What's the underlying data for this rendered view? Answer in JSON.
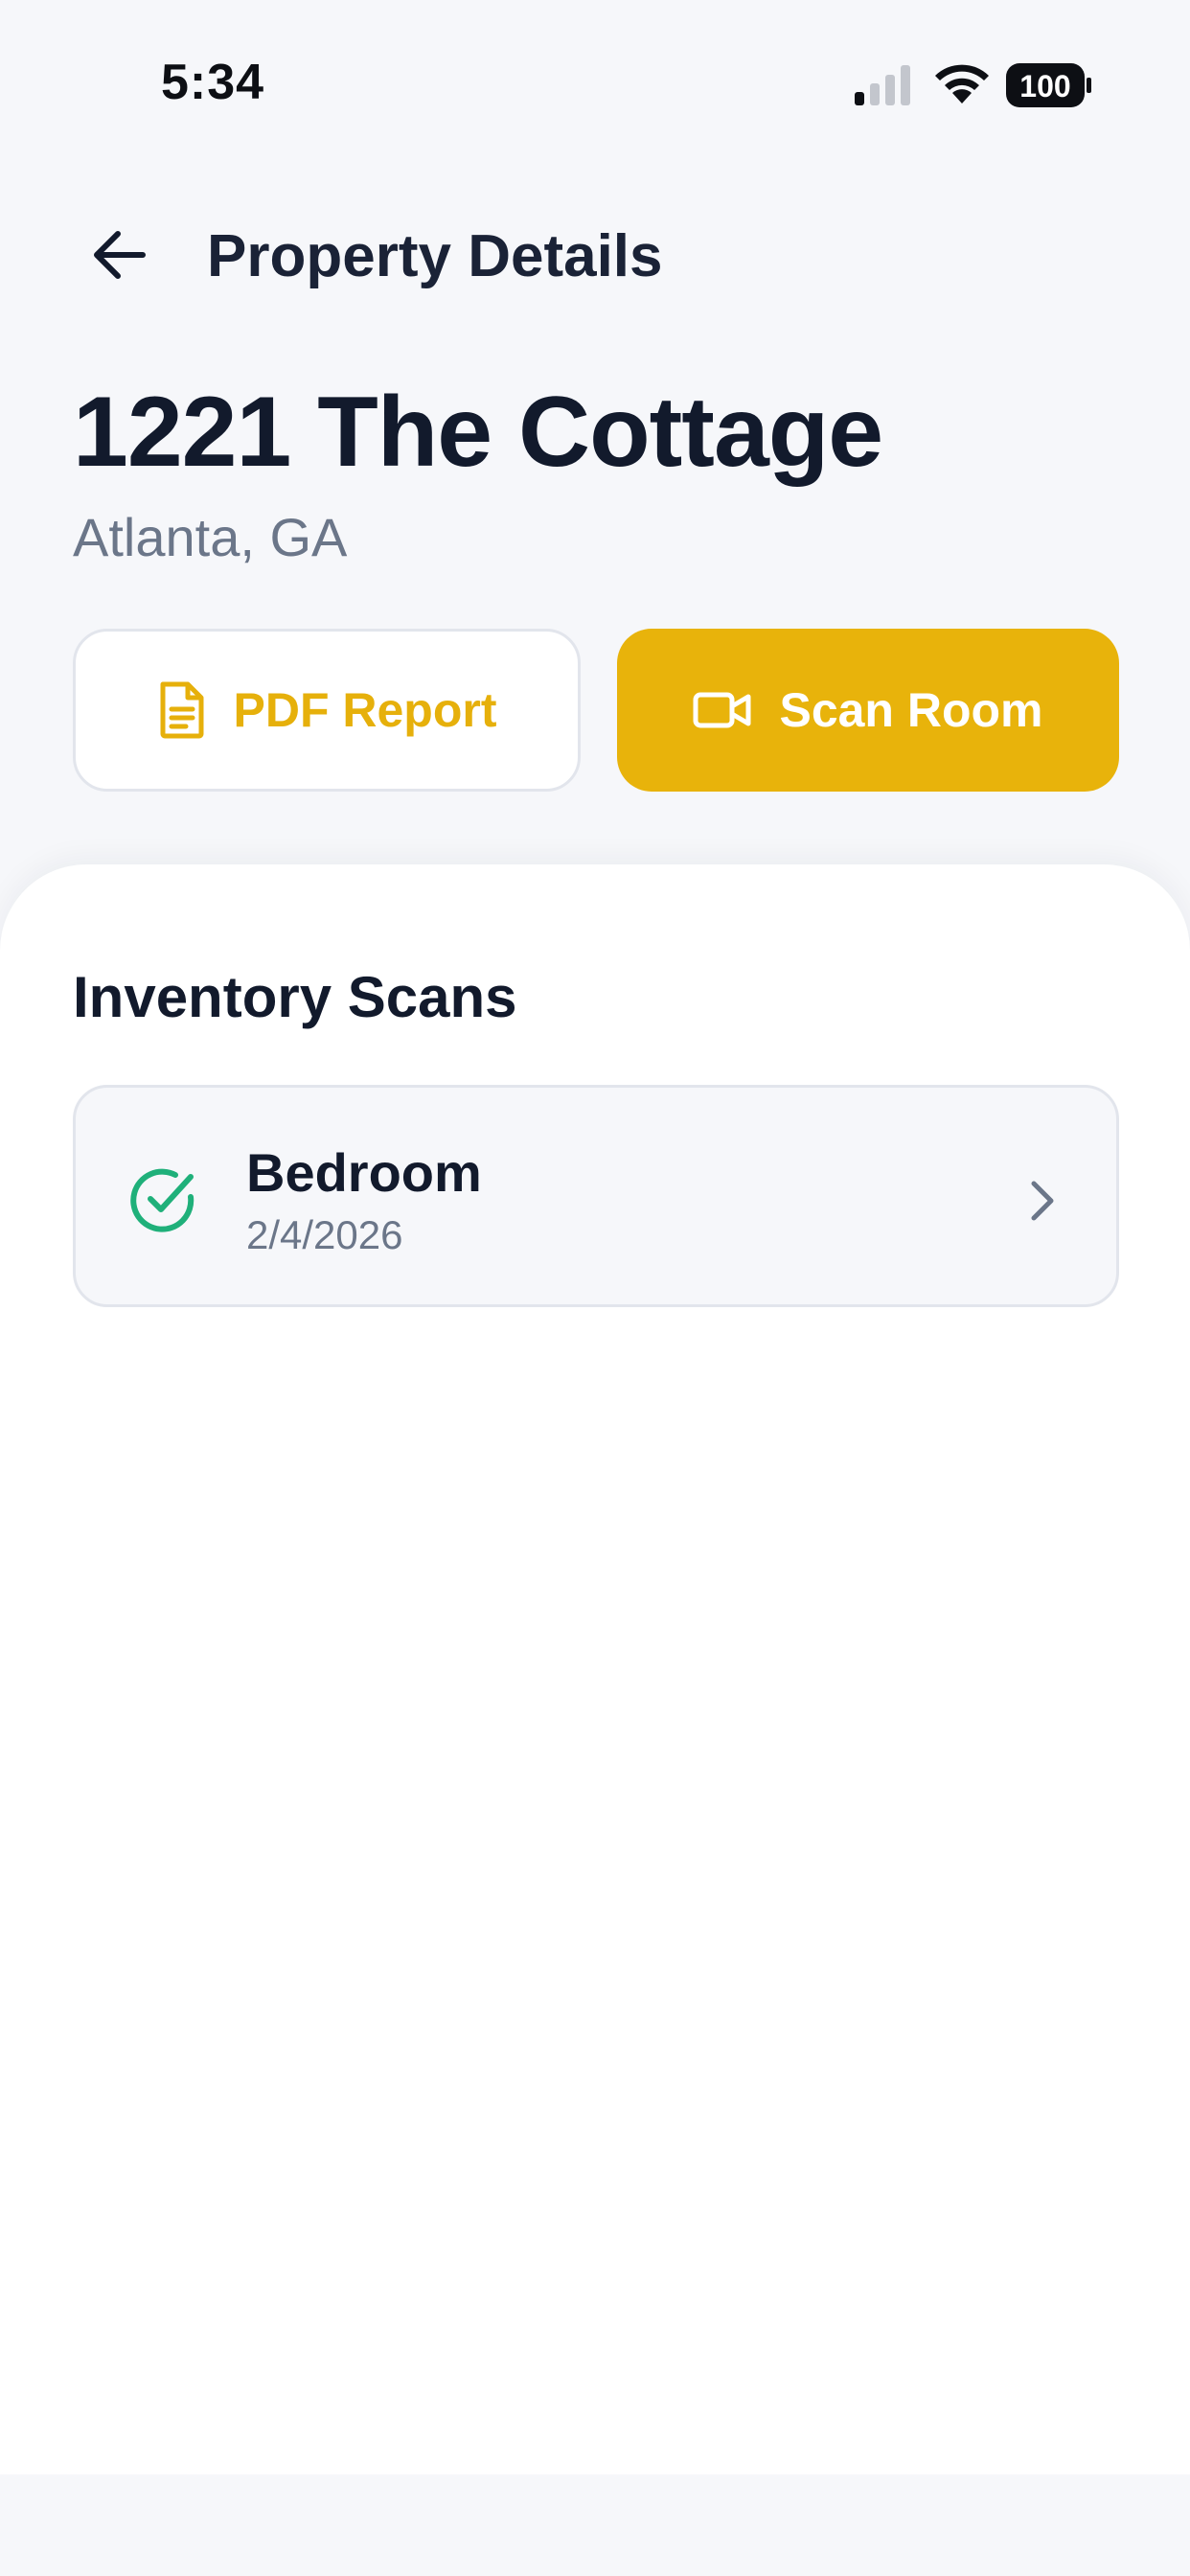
{
  "status_bar": {
    "time": "5:34",
    "battery": "100",
    "signal_icon": "cellular-signal-icon",
    "wifi_icon": "wifi-icon",
    "battery_icon": "battery-icon"
  },
  "header": {
    "back_icon": "arrow-left-icon",
    "title": "Property Details"
  },
  "property": {
    "name": "1221 The Cottage",
    "location": "Atlanta, GA"
  },
  "actions": {
    "pdf_label": "PDF Report",
    "pdf_icon": "document-icon",
    "scan_label": "Scan Room",
    "scan_icon": "video-camera-icon"
  },
  "inventory": {
    "title": "Inventory Scans",
    "items": [
      {
        "name": "Bedroom",
        "date": "2/4/2026",
        "status_icon": "check-circle-icon",
        "chevron_icon": "chevron-right-icon"
      }
    ]
  },
  "colors": {
    "accent": "#e8b30b",
    "success": "#1fb07a",
    "text_primary": "#121a2c",
    "text_secondary": "#6b7689",
    "background": "#f6f7fa"
  }
}
